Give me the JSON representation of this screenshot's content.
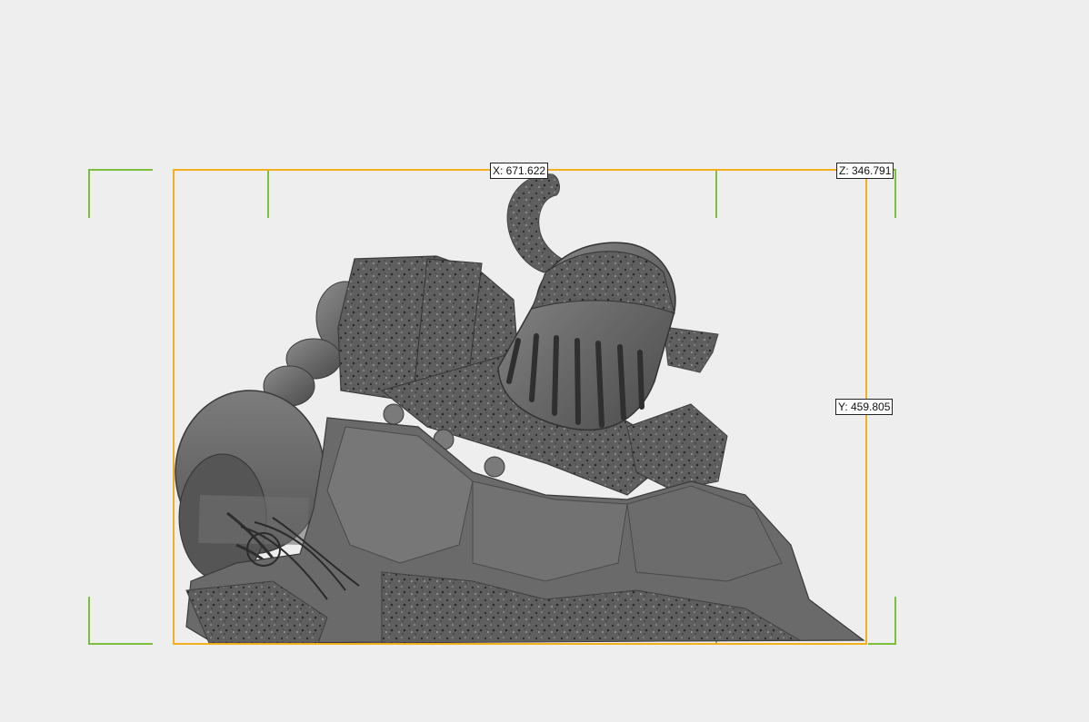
{
  "viewport": {
    "background": "#eeeeee"
  },
  "model": {
    "icon": "robot-knight-3d-mesh",
    "shading_color": "#6e6e6e"
  },
  "bounding_box": {
    "front_color": "#f2b01e",
    "back_color": "#7bbf3f"
  },
  "dimensions": {
    "x_label": "X: 671.622",
    "y_label": "Y: 459.805",
    "z_label": "Z: 346.791"
  }
}
